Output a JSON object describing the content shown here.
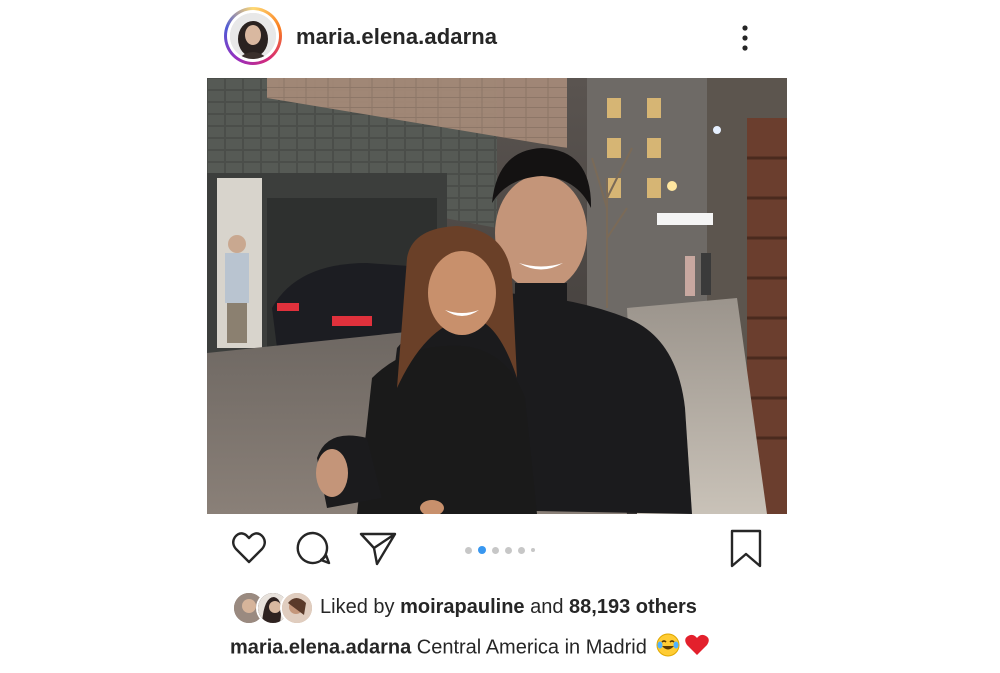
{
  "post": {
    "username": "maria.elena.adarna",
    "more_icon": "more-vertical-icon",
    "photo": {
      "carousel_count": 6,
      "carousel_active_index": 1
    }
  },
  "actions": {
    "like_icon": "heart-icon",
    "comment_icon": "comment-icon",
    "share_icon": "send-icon",
    "save_icon": "bookmark-icon"
  },
  "likes": {
    "prefix": "Liked by ",
    "liker": "moirapauline",
    "middle": " and ",
    "others": "88,193 others"
  },
  "caption": {
    "username": "maria.elena.adarna",
    "text": " Central America in Madrid",
    "emojis": [
      "face-with-tears-of-joy",
      "red-heart"
    ]
  },
  "colors": {
    "accent_blue": "#3897f0",
    "text": "#262626",
    "muted": "#8e8e8e"
  }
}
